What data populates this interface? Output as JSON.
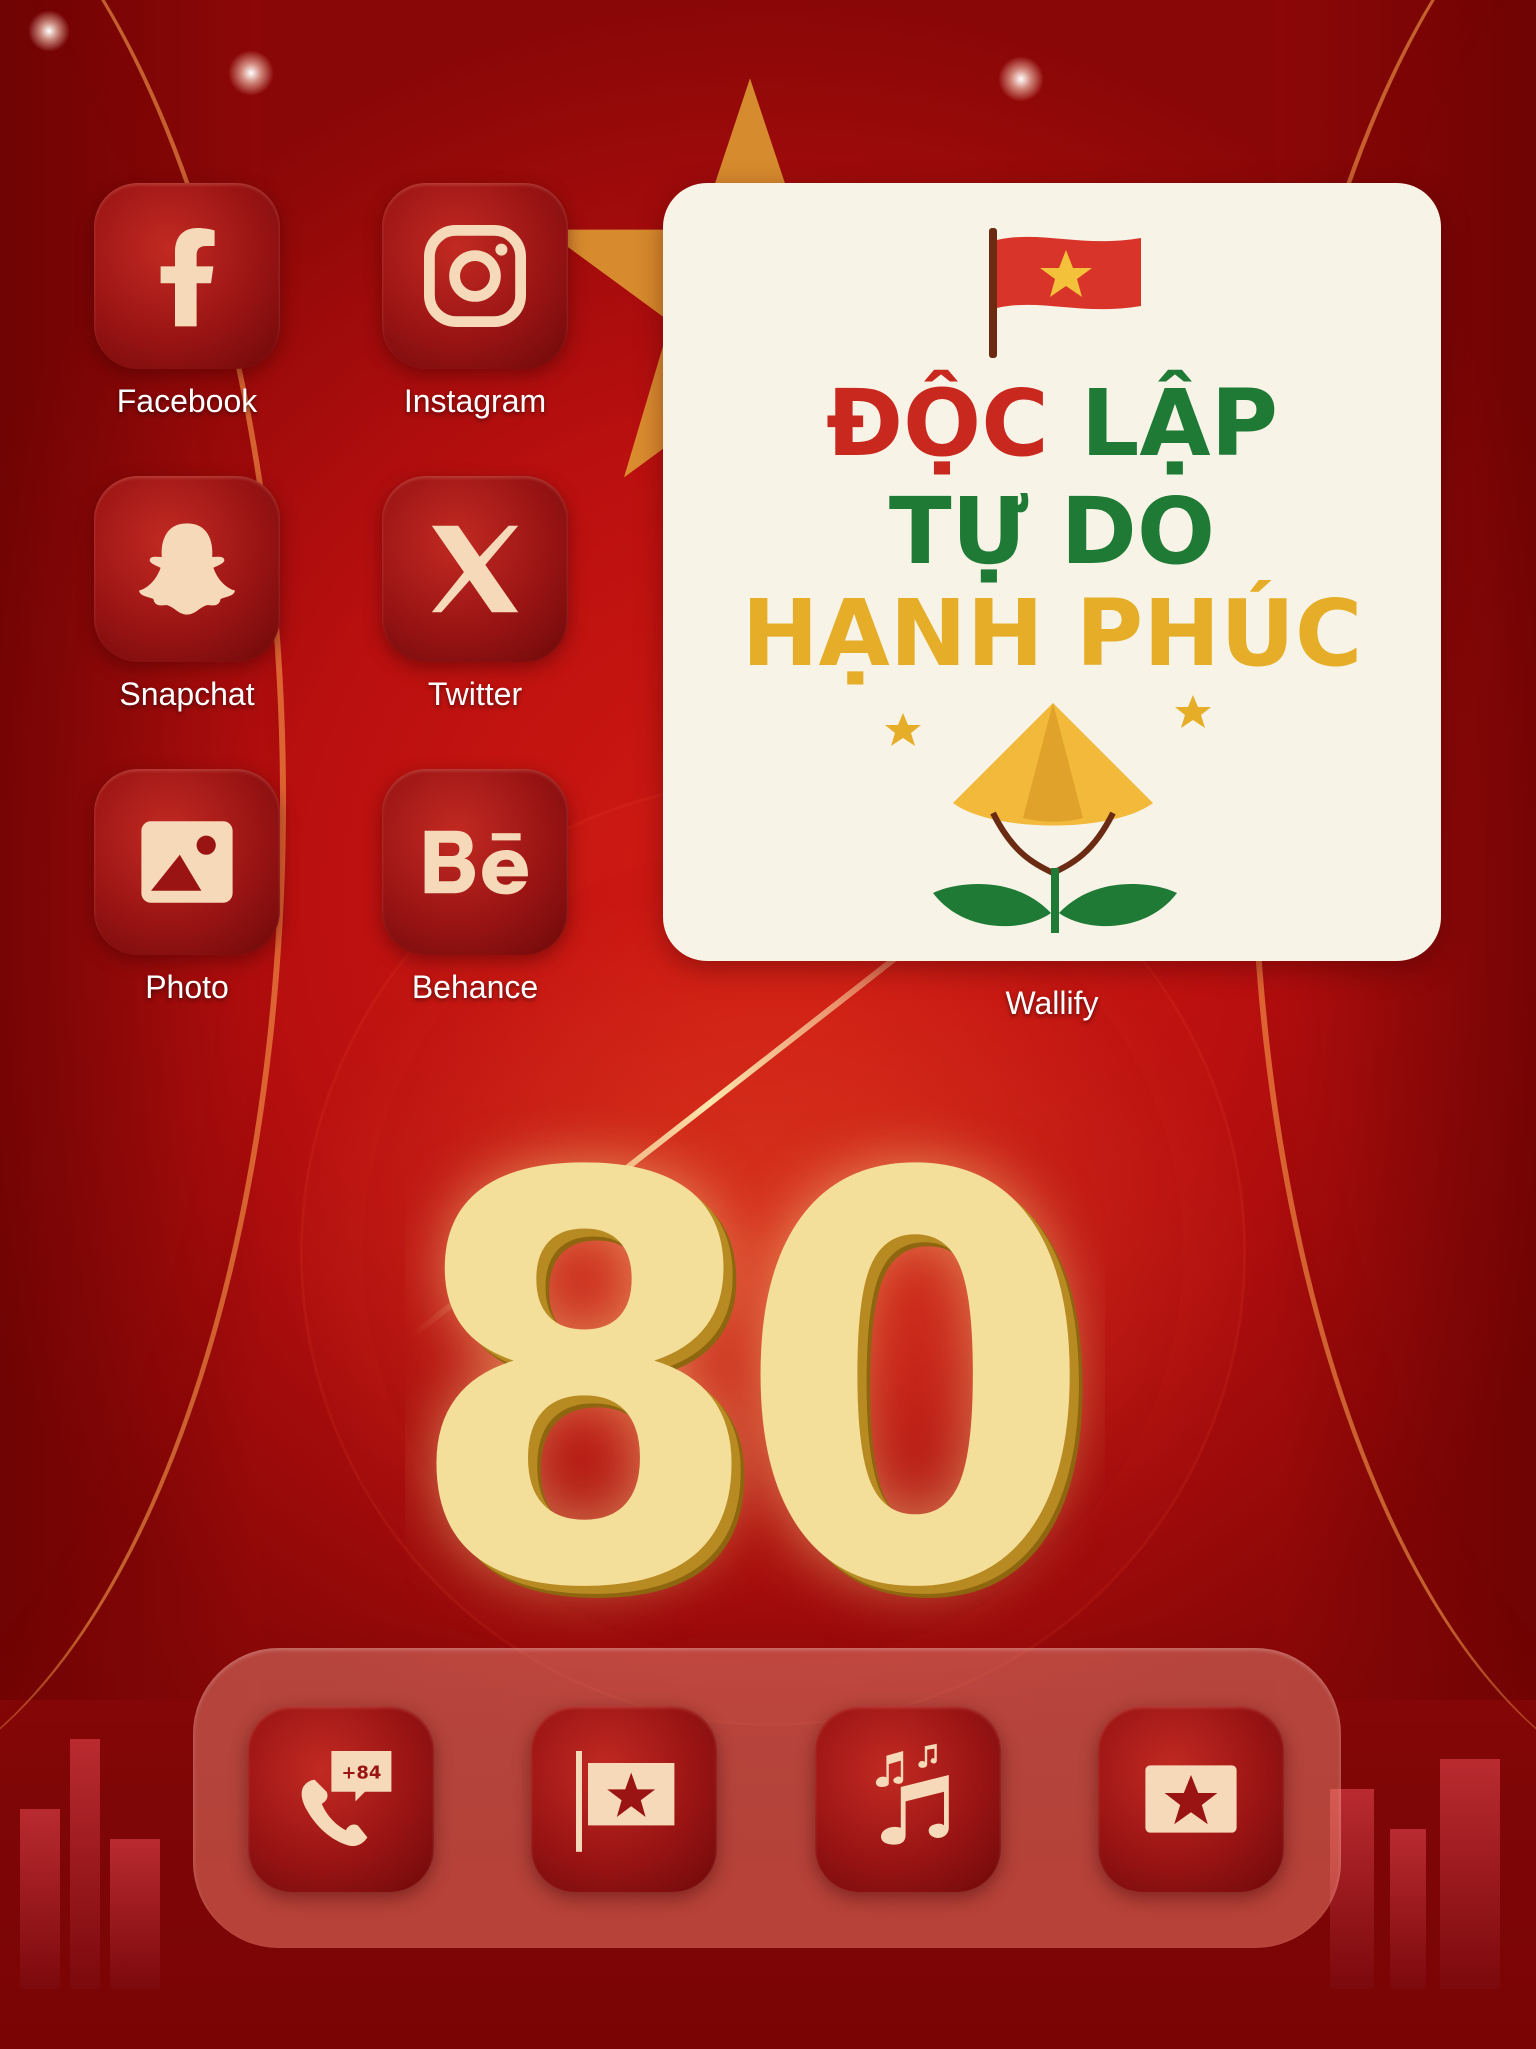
{
  "home_screen": {
    "apps": [
      {
        "label": "Facebook",
        "icon": "facebook-icon"
      },
      {
        "label": "Instagram",
        "icon": "instagram-icon"
      },
      {
        "label": "Snapchat",
        "icon": "snapchat-icon"
      },
      {
        "label": "Twitter",
        "icon": "twitter-x-icon"
      },
      {
        "label": "Photo",
        "icon": "photo-icon"
      },
      {
        "label": "Behance",
        "icon": "behance-icon"
      }
    ],
    "widget": {
      "label": "Wallify",
      "line1_word1": "ĐỘC",
      "line1_word2": "LẬP",
      "line2": "TỰ DO",
      "line3": "HẠNH PHÚC"
    }
  },
  "dock": {
    "apps": [
      {
        "icon": "phone-icon",
        "badge": "+84"
      },
      {
        "icon": "flag-icon"
      },
      {
        "icon": "music-icon"
      },
      {
        "icon": "star-icon"
      }
    ]
  },
  "wallpaper": {
    "number": "80"
  },
  "colors": {
    "background_red": "#b30f0f",
    "icon_cream": "#f6d9b8",
    "gold": "#f4df9a",
    "slogan_red": "#c8281e",
    "slogan_green": "#1e7a35",
    "slogan_yellow": "#e6ad28"
  }
}
